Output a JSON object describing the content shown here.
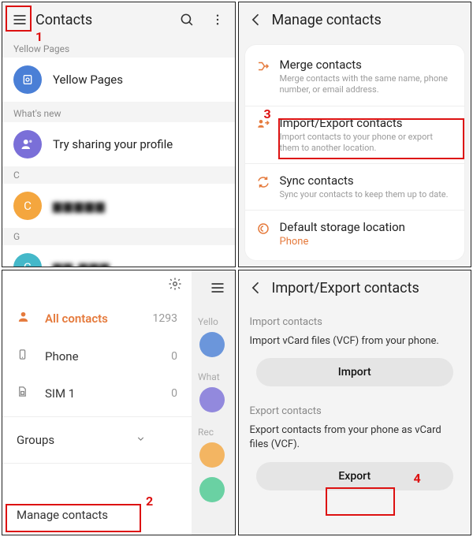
{
  "panel1": {
    "title": "Contacts",
    "sections": {
      "yellow_pages": {
        "label": "Yellow Pages",
        "item": "Yellow Pages"
      },
      "whats_new": {
        "label": "What's new",
        "item": "Try sharing your profile"
      },
      "letter_c": "C",
      "letter_g": "G",
      "contact_c_initial": "C",
      "contact_g_initial": "G",
      "redacted_c": "▆▆▆▆▆",
      "redacted_g": "▆▆ ▆▆▆"
    },
    "step_num": "1"
  },
  "panel2": {
    "title": "Manage contacts",
    "items": [
      {
        "title": "Merge contacts",
        "sub": "Merge contacts with the same name, phone number, or email address.",
        "icon": "merge"
      },
      {
        "title": "Import/Export contacts",
        "sub": "Import contacts to your phone or export them to another location.",
        "icon": "import-export"
      },
      {
        "title": "Sync contacts",
        "sub": "Sync your contacts to keep them up to date.",
        "icon": "sync"
      },
      {
        "title": "Default storage location",
        "accent": "Phone",
        "icon": "storage"
      }
    ],
    "step_num": "3"
  },
  "panel3": {
    "items": [
      {
        "label": "All contacts",
        "count": "1293",
        "icon": "person",
        "active": true
      },
      {
        "label": "Phone",
        "count": "0",
        "icon": "phone"
      },
      {
        "label": "SIM 1",
        "count": "0",
        "icon": "sim"
      }
    ],
    "groups_label": "Groups",
    "manage_label": "Manage contacts",
    "back_labels": {
      "yellow": "Yello",
      "whats": "What",
      "rec": "Rec"
    },
    "step_num": "2"
  },
  "panel4": {
    "title": "Import/Export contacts",
    "import_sec": "Import contacts",
    "import_txt": "Import vCard files (VCF) from your phone.",
    "import_btn": "Import",
    "export_sec": "Export contacts",
    "export_txt": "Export contacts from your phone as vCard files (VCF).",
    "export_btn": "Export",
    "step_num": "4"
  }
}
